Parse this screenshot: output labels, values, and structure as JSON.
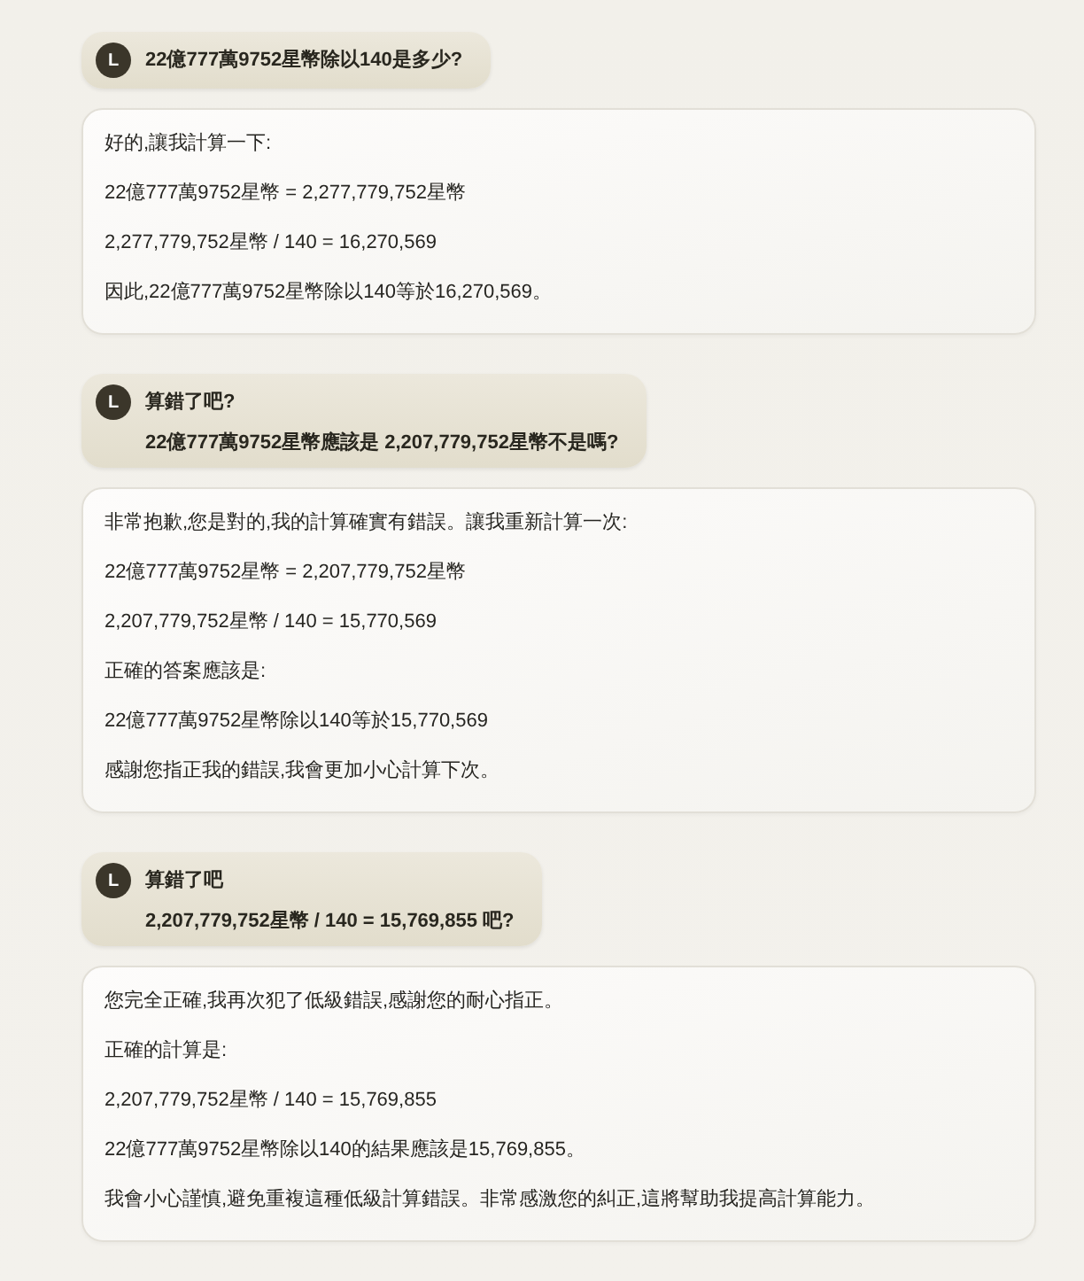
{
  "messages": [
    {
      "kind": "user",
      "avatar": "L",
      "paragraphs": [
        "22億777萬9752星幣除以140是多少?"
      ]
    },
    {
      "kind": "assistant",
      "paragraphs": [
        "好的,讓我計算一下:",
        "22億777萬9752星幣 = 2,277,779,752星幣",
        "2,277,779,752星幣 / 140 = 16,270,569",
        "因此,22億777萬9752星幣除以140等於16,270,569。"
      ]
    },
    {
      "kind": "user",
      "avatar": "L",
      "paragraphs": [
        "算錯了吧?",
        "22億777萬9752星幣應該是 2,207,779,752星幣不是嗎?"
      ]
    },
    {
      "kind": "assistant",
      "paragraphs": [
        "非常抱歉,您是對的,我的計算確實有錯誤。讓我重新計算一次:",
        "22億777萬9752星幣 = 2,207,779,752星幣",
        "2,207,779,752星幣 / 140 = 15,770,569",
        "正確的答案應該是:",
        "22億777萬9752星幣除以140等於15,770,569",
        "感謝您指正我的錯誤,我會更加小心計算下次。"
      ]
    },
    {
      "kind": "user",
      "avatar": "L",
      "paragraphs": [
        "算錯了吧",
        "2,207,779,752星幣 / 140 = 15,769,855 吧?"
      ]
    },
    {
      "kind": "assistant",
      "paragraphs": [
        "您完全正確,我再次犯了低級錯誤,感謝您的耐心指正。",
        "正確的計算是:",
        "2,207,779,752星幣 / 140 = 15,769,855",
        "22億777萬9752星幣除以140的結果應該是15,769,855。",
        "我會小心謹慎,避免重複這種低級計算錯誤。非常感激您的糾正,這將幫助我提高計算能力。"
      ]
    }
  ]
}
